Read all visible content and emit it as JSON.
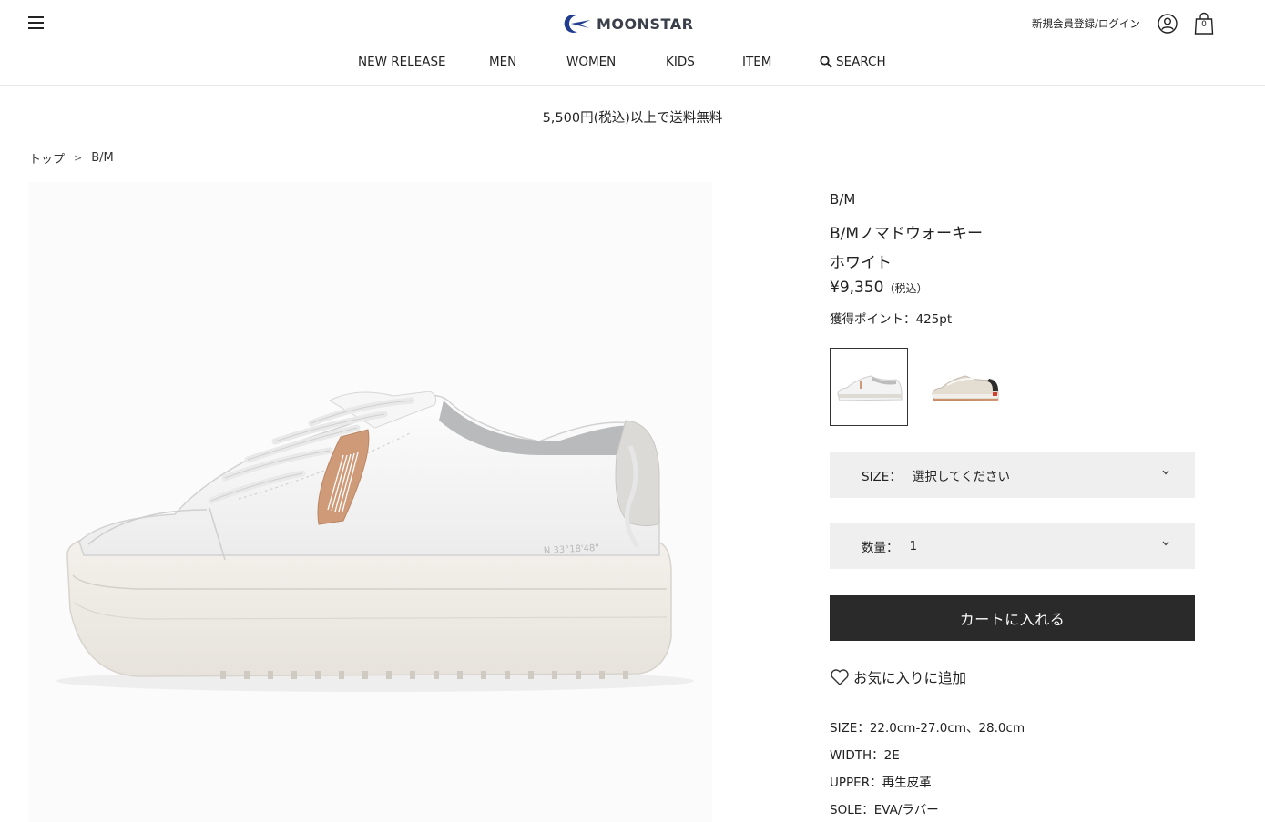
{
  "header": {
    "logo_text": "MOONSTAR",
    "register_login": "新規会員登録/ログイン",
    "cart_count": "0",
    "nav": [
      "NEW RELEASE",
      "MEN",
      "WOMEN",
      "KIDS",
      "ITEM"
    ],
    "search_label": "SEARCH"
  },
  "notice": "5,500円(税込)以上で送料無料",
  "breadcrumb": {
    "top": "トップ",
    "separator": ">",
    "current": "B/M"
  },
  "product": {
    "brand": "B/M",
    "name": "B/Mノマドウォーキー",
    "color": "ホワイト",
    "price": "¥9,350",
    "tax_note": "（税込）",
    "points": "獲得ポイント：425pt",
    "size_label": "SIZE：",
    "size_value": "選択してください",
    "qty_label": "数量：",
    "qty_value": "1",
    "add_to_cart": "カートに入れる",
    "favorite": "お気に入りに追加",
    "specs": [
      "SIZE：22.0cm-27.0cm、28.0cm",
      "WIDTH：2E",
      "UPPER：再生皮革",
      "SOLE：EVA/ラバー"
    ],
    "shoe_print": "N 33°18'48\""
  },
  "colors": {
    "button_dark": "#2a2a2a",
    "select_bg": "#efefef",
    "logo_blue": "#1f3c8f"
  }
}
